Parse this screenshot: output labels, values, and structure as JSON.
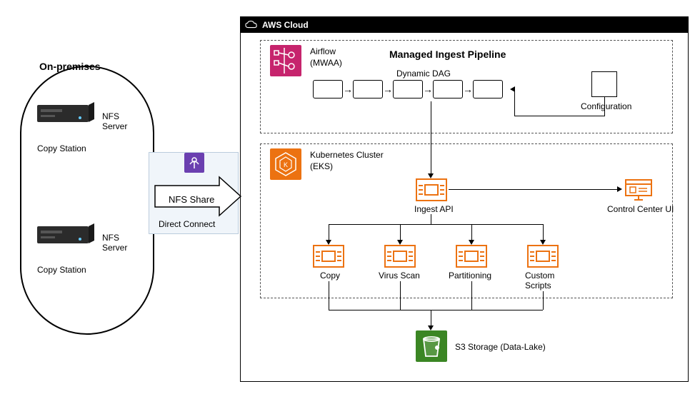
{
  "onprem": {
    "title": "On-premises",
    "server1": {
      "name": "NFS\nServer",
      "station": "Copy Station"
    },
    "server2": {
      "name": "NFS\nServer",
      "station": "Copy Station"
    }
  },
  "arrow": {
    "nfs_share": "NFS Share",
    "direct_connect": "Direct Connect"
  },
  "aws": {
    "title": "AWS Cloud",
    "airflow": {
      "name": "Airflow\n(MWAA)",
      "pipeline_title": "Managed Ingest Pipeline",
      "dag_label": "Dynamic DAG",
      "configuration": "Configuration"
    },
    "eks": {
      "name": "Kubernetes Cluster\n(EKS)",
      "ingest_api": "Ingest API",
      "control_center": "Control Center UI",
      "copy": "Copy",
      "virus_scan": "Virus Scan",
      "partitioning": "Partitioning",
      "custom_scripts": "Custom\nScripts"
    },
    "s3": "S3 Storage (Data-Lake)"
  }
}
